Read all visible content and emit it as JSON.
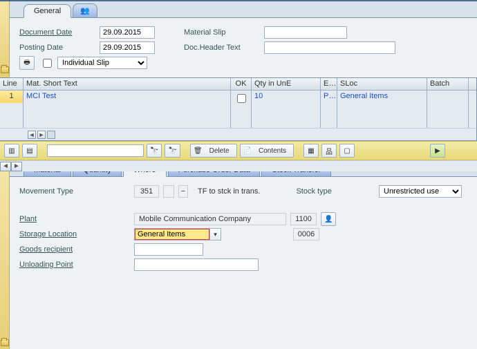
{
  "top_tabs": {
    "general": "General"
  },
  "header": {
    "document_date_label": "Document Date",
    "document_date": "29.09.2015",
    "posting_date_label": "Posting Date",
    "posting_date": "29.09.2015",
    "material_slip_label": "Material Slip",
    "material_slip": "",
    "doc_header_text_label": "Doc.Header Text",
    "doc_header_text": "",
    "slip_type": "Individual Slip"
  },
  "grid": {
    "columns": {
      "line": "Line",
      "mat_short_text": "Mat. Short Text",
      "ok": "OK",
      "qty_in_une": "Qty in UnE",
      "e": "E...",
      "sloc": "SLoc",
      "batch": "Batch"
    },
    "rows": [
      {
        "line": "1",
        "text": "MCI Test",
        "ok": false,
        "qty": "10",
        "e": "PC",
        "sloc": "General Items",
        "batch": ""
      }
    ]
  },
  "midtoolbar": {
    "filter": "",
    "delete_label": "Delete",
    "contents_label": "Contents"
  },
  "detail_tabs": {
    "material": "Material",
    "quantity": "Quantity",
    "where": "Where",
    "po_data": "Purchase Order Data",
    "stock_transfer": "Stock Transfer"
  },
  "where": {
    "movement_type_label": "Movement Type",
    "movement_type": "351",
    "movement_type_text": "TF to stck in trans.",
    "stock_type_label": "Stock type",
    "stock_type": "Unrestricted use",
    "plant_label": "Plant",
    "plant_text": "Mobile Communication Company",
    "plant_code": "1100",
    "storage_location_label": "Storage Location",
    "storage_location_text": "General Items",
    "storage_location_code": "0006",
    "goods_recipient_label": "Goods recipient",
    "goods_recipient": "",
    "unloading_point_label": "Unloading Point",
    "unloading_point": ""
  }
}
